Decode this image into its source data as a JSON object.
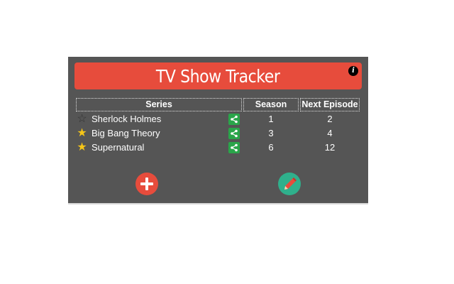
{
  "app": {
    "title": "TV Show Tracker"
  },
  "table": {
    "headers": {
      "series": "Series",
      "season": "Season",
      "next_episode": "Next Episode"
    },
    "rows": [
      {
        "series": "Sherlock Holmes",
        "season": "1",
        "next_episode": "2",
        "favorite": false
      },
      {
        "series": "Big Bang Theory",
        "season": "3",
        "next_episode": "4",
        "favorite": true
      },
      {
        "series": "Supernatural",
        "season": "6",
        "next_episode": "12",
        "favorite": true
      }
    ]
  },
  "icons": {
    "info": "info-icon",
    "favorite": "star-icon",
    "share": "share-icon",
    "add": "plus-icon",
    "edit": "pencil-icon"
  },
  "colors": {
    "panel": "#555555",
    "title_bar": "#e74c3c",
    "share": "#2aa54a",
    "add": "#e74c3c",
    "edit": "#2fb08c",
    "star": "#f5c518"
  }
}
